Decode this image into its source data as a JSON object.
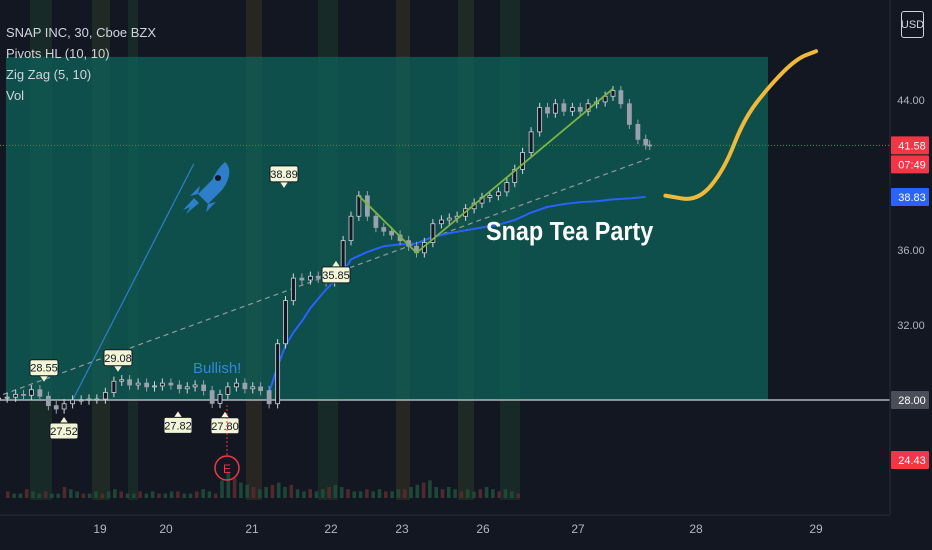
{
  "header": {
    "symbol_line": "SNAP INC, 30, Cboe BZX",
    "indicators": [
      "Pivots HL (10, 10)",
      "Zig Zag (5, 10)",
      "Vol"
    ]
  },
  "currency_button": "USD",
  "colors": {
    "background": "#131722",
    "price": "#d1d4dc",
    "ma_line": "#2962ff",
    "zigzag": "#7cb342",
    "target_zone": "#0f5e56",
    "stop_zone": "#5a2226",
    "trendline": "#9598a1",
    "forecast_path": "#f0b93a",
    "rocket": "#2f7ec9",
    "current_price_badge": "#f23645",
    "ma_badge": "#2962ff",
    "entry_badge": "#4a4e58"
  },
  "annotations": {
    "title_text": "Snap Tea Party",
    "bullish_text": "Bullish!",
    "earnings_marker": "E"
  },
  "chart_data": {
    "type": "candlestick",
    "x_axis_labels": [
      "19",
      "20",
      "21",
      "22",
      "23",
      "26",
      "27",
      "28",
      "29"
    ],
    "y_axis_ticks": [
      "44.00",
      "36.00",
      "32.00",
      "28.00"
    ],
    "y_range": [
      21.0,
      48.5
    ],
    "price_badges": {
      "current_price": "41.58",
      "countdown": "07:49",
      "moving_average": "38.83",
      "entry": "28.00",
      "stop": "24.43"
    },
    "pivot_labels": [
      {
        "text": "28.55",
        "type": "high",
        "session": "18",
        "price": 28.55
      },
      {
        "text": "27.52",
        "type": "low",
        "session": "18",
        "price": 27.52
      },
      {
        "text": "29.08",
        "type": "high",
        "session": "19",
        "price": 29.08
      },
      {
        "text": "27.82",
        "type": "low",
        "session": "20",
        "price": 27.82
      },
      {
        "text": "27.80",
        "type": "low",
        "session": "20",
        "price": 27.8
      },
      {
        "text": "38.89",
        "type": "high",
        "session": "21",
        "price": 38.89
      },
      {
        "text": "35.85",
        "type": "low",
        "session": "22",
        "price": 35.85
      }
    ],
    "zones": {
      "target_zone": {
        "from": 28.0,
        "to": 46.3
      },
      "stop_zone": {
        "from": 24.43,
        "to": 28.0
      },
      "current_price_line": 41.58
    },
    "series": [
      {
        "name": "",
        "type": "ohlc",
        "points": [
          {
            "x": 0.5,
            "y": 28.0
          },
          {
            "x": 0.62,
            "y": 28.1
          },
          {
            "x": 0.75,
            "y": 28.15
          },
          {
            "x": 0.88,
            "y": 28.3
          },
          {
            "x": 1.0,
            "y": 28.25
          },
          {
            "x": 1.12,
            "y": 28.55
          },
          {
            "x": 1.25,
            "y": 28.2
          },
          {
            "x": 1.38,
            "y": 27.7
          },
          {
            "x": 1.5,
            "y": 27.52
          },
          {
            "x": 1.62,
            "y": 27.8
          },
          {
            "x": 1.75,
            "y": 28.0
          },
          {
            "x": 1.88,
            "y": 28.0
          },
          {
            "x": 2.0,
            "y": 28.05
          },
          {
            "x": 2.12,
            "y": 28.05
          },
          {
            "x": 2.25,
            "y": 28.4
          },
          {
            "x": 2.38,
            "y": 29.0
          },
          {
            "x": 2.5,
            "y": 29.08
          },
          {
            "x": 2.62,
            "y": 28.8
          },
          {
            "x": 2.75,
            "y": 28.9
          },
          {
            "x": 2.88,
            "y": 28.7
          },
          {
            "x": 3.0,
            "y": 28.75
          },
          {
            "x": 3.12,
            "y": 28.9
          },
          {
            "x": 3.25,
            "y": 28.8
          },
          {
            "x": 3.38,
            "y": 28.6
          },
          {
            "x": 3.5,
            "y": 28.7
          },
          {
            "x": 3.62,
            "y": 28.8
          },
          {
            "x": 3.75,
            "y": 28.5
          },
          {
            "x": 3.88,
            "y": 27.82
          },
          {
            "x": 4.0,
            "y": 28.3
          },
          {
            "x": 4.12,
            "y": 28.7
          },
          {
            "x": 4.25,
            "y": 28.9
          },
          {
            "x": 4.38,
            "y": 28.6
          },
          {
            "x": 4.5,
            "y": 28.7
          },
          {
            "x": 4.62,
            "y": 28.5
          },
          {
            "x": 4.75,
            "y": 27.8
          },
          {
            "x": 4.88,
            "y": 31.0
          },
          {
            "x": 5.0,
            "y": 33.3
          },
          {
            "x": 5.12,
            "y": 34.5
          },
          {
            "x": 5.25,
            "y": 34.4
          },
          {
            "x": 5.38,
            "y": 34.6
          },
          {
            "x": 5.5,
            "y": 34.5
          },
          {
            "x": 5.62,
            "y": 34.3
          },
          {
            "x": 5.75,
            "y": 35.0
          },
          {
            "x": 5.88,
            "y": 36.5
          },
          {
            "x": 6.0,
            "y": 37.8
          },
          {
            "x": 6.12,
            "y": 38.89
          },
          {
            "x": 6.25,
            "y": 37.8
          },
          {
            "x": 6.38,
            "y": 37.2
          },
          {
            "x": 6.5,
            "y": 37.0
          },
          {
            "x": 6.62,
            "y": 36.8
          },
          {
            "x": 6.75,
            "y": 36.5
          },
          {
            "x": 6.88,
            "y": 36.2
          },
          {
            "x": 7.0,
            "y": 35.85
          },
          {
            "x": 7.12,
            "y": 36.4
          },
          {
            "x": 7.25,
            "y": 37.4
          },
          {
            "x": 7.38,
            "y": 37.6
          },
          {
            "x": 7.5,
            "y": 37.7
          },
          {
            "x": 7.62,
            "y": 37.8
          },
          {
            "x": 7.75,
            "y": 38.2
          },
          {
            "x": 7.88,
            "y": 38.5
          },
          {
            "x": 8.0,
            "y": 38.8
          },
          {
            "x": 8.12,
            "y": 38.9
          },
          {
            "x": 8.25,
            "y": 39.1
          },
          {
            "x": 8.38,
            "y": 39.6
          },
          {
            "x": 8.5,
            "y": 40.3
          },
          {
            "x": 8.62,
            "y": 41.2
          },
          {
            "x": 8.75,
            "y": 42.3
          },
          {
            "x": 8.88,
            "y": 43.6
          },
          {
            "x": 9.0,
            "y": 43.3
          },
          {
            "x": 9.12,
            "y": 43.8
          },
          {
            "x": 9.25,
            "y": 43.4
          },
          {
            "x": 9.38,
            "y": 43.6
          },
          {
            "x": 9.5,
            "y": 43.4
          },
          {
            "x": 9.62,
            "y": 43.8
          },
          {
            "x": 9.75,
            "y": 43.9
          },
          {
            "x": 9.88,
            "y": 44.2
          },
          {
            "x": 10.0,
            "y": 44.5
          },
          {
            "x": 10.12,
            "y": 43.8
          },
          {
            "x": 10.25,
            "y": 42.7
          },
          {
            "x": 10.38,
            "y": 41.9
          },
          {
            "x": 10.5,
            "y": 41.6
          },
          {
            "x": 10.56,
            "y": 41.58
          }
        ]
      },
      {
        "name": "",
        "type": "moving_average",
        "points": [
          {
            "x": 4.75,
            "y": 28.4
          },
          {
            "x": 4.88,
            "y": 29.8
          },
          {
            "x": 5.0,
            "y": 30.9
          },
          {
            "x": 5.12,
            "y": 31.6
          },
          {
            "x": 5.25,
            "y": 32.2
          },
          {
            "x": 5.38,
            "y": 32.9
          },
          {
            "x": 5.62,
            "y": 33.9
          },
          {
            "x": 5.88,
            "y": 34.8
          },
          {
            "x": 6.0,
            "y": 35.5
          },
          {
            "x": 6.25,
            "y": 35.9
          },
          {
            "x": 6.5,
            "y": 36.2
          },
          {
            "x": 6.75,
            "y": 36.3
          },
          {
            "x": 7.0,
            "y": 36.35
          },
          {
            "x": 7.25,
            "y": 36.7
          },
          {
            "x": 7.5,
            "y": 36.9
          },
          {
            "x": 7.75,
            "y": 37.05
          },
          {
            "x": 8.0,
            "y": 37.2
          },
          {
            "x": 8.25,
            "y": 37.35
          },
          {
            "x": 8.5,
            "y": 37.6
          },
          {
            "x": 8.75,
            "y": 38.0
          },
          {
            "x": 9.0,
            "y": 38.3
          },
          {
            "x": 9.25,
            "y": 38.45
          },
          {
            "x": 9.5,
            "y": 38.55
          },
          {
            "x": 9.75,
            "y": 38.6
          },
          {
            "x": 10.0,
            "y": 38.7
          },
          {
            "x": 10.25,
            "y": 38.75
          },
          {
            "x": 10.5,
            "y": 38.83
          }
        ]
      },
      {
        "name": "",
        "type": "zigzag",
        "points": [
          {
            "x": 6.12,
            "y": 38.89
          },
          {
            "x": 7.0,
            "y": 35.85
          },
          {
            "x": 10.0,
            "y": 44.6
          }
        ]
      }
    ],
    "trendline": {
      "from": {
        "x": 0.3,
        "y": 27.8
      },
      "to": {
        "x": 10.56,
        "y": 40.9
      }
    },
    "forecast_path": [
      {
        "x": 10.8,
        "y": 38.9
      },
      {
        "x": 11.3,
        "y": 38.6
      },
      {
        "x": 11.7,
        "y": 40.3
      },
      {
        "x": 12.0,
        "y": 43.0
      },
      {
        "x": 12.4,
        "y": 44.8
      },
      {
        "x": 12.8,
        "y": 46.2
      },
      {
        "x": 13.1,
        "y": 46.6
      }
    ],
    "volume": [
      3,
      2,
      2,
      4,
      3,
      2,
      3,
      2,
      2,
      5,
      4,
      3,
      2,
      2,
      3,
      2,
      3,
      4,
      3,
      2,
      2,
      3,
      2,
      3,
      2,
      2,
      3,
      3,
      2,
      2,
      3,
      4,
      3,
      2,
      8,
      12,
      9,
      7,
      6,
      5,
      4,
      5,
      6,
      7,
      5,
      6,
      4,
      3,
      4,
      3,
      4,
      5,
      6,
      5,
      4,
      3,
      3,
      4,
      3,
      4,
      3,
      3,
      4,
      4,
      5,
      6,
      7,
      8,
      5,
      4,
      5,
      4,
      3,
      4,
      3,
      4,
      5,
      4,
      3,
      4,
      3,
      2
    ],
    "legend": "none",
    "grid": false
  }
}
